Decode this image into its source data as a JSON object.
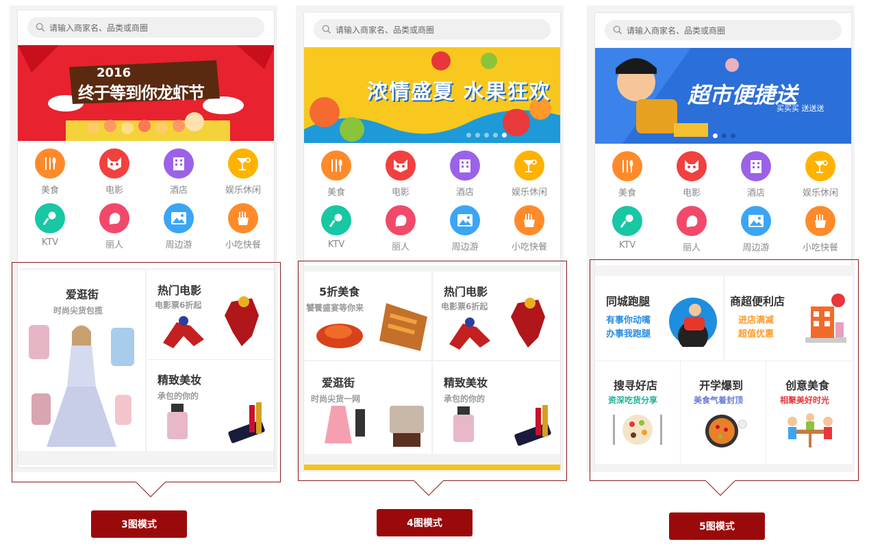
{
  "search_placeholder": "请输入商家名、品类或商圈",
  "categories": [
    {
      "label": "美食",
      "icon": "fork-knife-icon",
      "color": "#ff8a2a"
    },
    {
      "label": "电影",
      "icon": "cat-face-icon",
      "color": "#f2403f"
    },
    {
      "label": "酒店",
      "icon": "building-icon",
      "color": "#9b62e8"
    },
    {
      "label": "娱乐休闲",
      "icon": "cocktail-icon",
      "color": "#ffb300"
    },
    {
      "label": "KTV",
      "icon": "microphone-icon",
      "color": "#18c7a3"
    },
    {
      "label": "丽人",
      "icon": "woman-face-icon",
      "color": "#f2496b"
    },
    {
      "label": "周边游",
      "icon": "landscape-icon",
      "color": "#3ba5f5"
    },
    {
      "label": "小吃快餐",
      "icon": "fries-icon",
      "color": "#ff8a2a"
    }
  ],
  "modes": [
    {
      "label": "3图模式",
      "banner": {
        "year": "2016",
        "headline": "终于等到你龙虾节",
        "bg": "#e8222e"
      },
      "cells": [
        {
          "title": "爱逛街",
          "sub": "时尚尖货包揽"
        },
        {
          "title": "热门电影",
          "sub": "电影票6折起"
        },
        {
          "title": "精致美妆",
          "sub": "承包的你的"
        }
      ]
    },
    {
      "label": "4图模式",
      "banner": {
        "headline": "浓情盛夏 水果狂欢",
        "bg": "#f8c81e"
      },
      "cells": [
        {
          "title": "5折美食",
          "sub": "饕餮盛宴等你来"
        },
        {
          "title": "热门电影",
          "sub": "电影票6折起"
        },
        {
          "title": "爱逛街",
          "sub": "时尚尖货一网"
        },
        {
          "title": "精致美妆",
          "sub": "承包的你的"
        }
      ]
    },
    {
      "label": "5图模式",
      "banner": {
        "headline": "超市便捷送",
        "tag": "买买买 送送送",
        "bg": "#2b6fd8"
      },
      "cells": [
        {
          "title": "同城跑腿",
          "sub1": "有事你动嘴",
          "sub2": "办事我跑腿",
          "color": "#2a8ee0"
        },
        {
          "title": "商超便利店",
          "sub1": "进店满减",
          "sub2": "超值优惠",
          "color": "#ff9a2a"
        },
        {
          "title": "搜寻好店",
          "sub1": "资深吃货分享",
          "color": "#1ab394"
        },
        {
          "title": "开学爆到",
          "sub1": "美食气着封顶",
          "color": "#6a7bd8"
        },
        {
          "title": "创意美食",
          "sub1": "相聚美好时光",
          "color": "#e8363a"
        }
      ]
    }
  ]
}
